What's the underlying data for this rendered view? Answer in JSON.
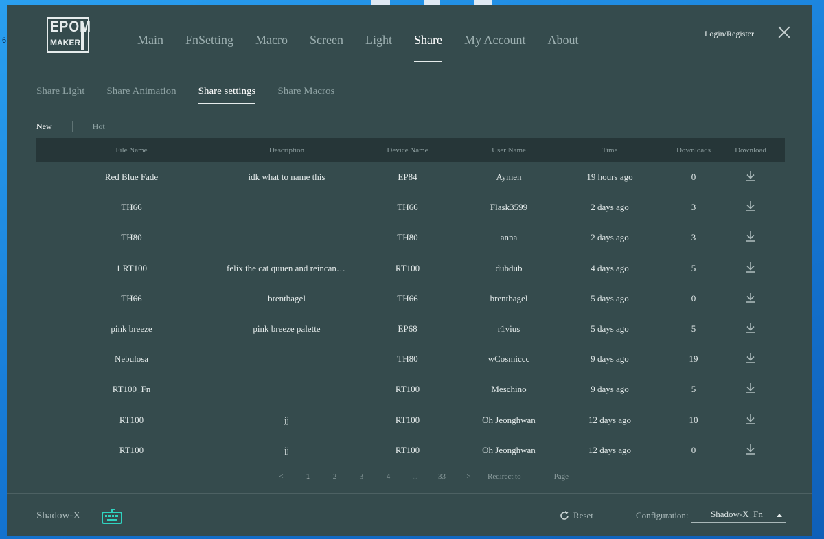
{
  "logo": {
    "line1": "EPOM",
    "line2": "MAKER"
  },
  "nav": [
    "Main",
    "FnSetting",
    "Macro",
    "Screen",
    "Light",
    "Share",
    "My Account",
    "About"
  ],
  "nav_active": "Share",
  "header": {
    "login_label": "Login/Register"
  },
  "subtabs": [
    "Share Light",
    "Share Animation",
    "Share settings",
    "Share Macros"
  ],
  "subtab_active": "Share settings",
  "filters": [
    "New",
    "Hot"
  ],
  "filter_active": "New",
  "table": {
    "columns": [
      "File Name",
      "Description",
      "Device Name",
      "User Name",
      "Time",
      "Downloads",
      "Download"
    ],
    "rows": [
      [
        "Red Blue Fade",
        "idk what to name this",
        "EP84",
        "Aymen",
        "19 hours ago",
        "0"
      ],
      [
        "TH66",
        "",
        "TH66",
        "Flask3599",
        "2 days ago",
        "3"
      ],
      [
        "TH80",
        "",
        "TH80",
        "anna",
        "2 days ago",
        "3"
      ],
      [
        "1 RT100",
        "felix the cat quuen and reincanated…",
        "RT100",
        "dubdub",
        "4 days ago",
        "5"
      ],
      [
        "TH66",
        "brentbagel",
        "TH66",
        "brentbagel",
        "5 days ago",
        "0"
      ],
      [
        "pink breeze",
        "pink breeze palette",
        "EP68",
        "r1vius",
        "5 days ago",
        "5"
      ],
      [
        "Nebulosa",
        "",
        "TH80",
        "wCosmiccc",
        "9 days ago",
        "19"
      ],
      [
        "RT100_Fn",
        "",
        "RT100",
        "Meschino",
        "9 days ago",
        "5"
      ],
      [
        "RT100",
        "jj",
        "RT100",
        "Oh Jeonghwan",
        "12 days ago",
        "10"
      ],
      [
        "RT100",
        "jj",
        "RT100",
        "Oh Jeonghwan",
        "12 days ago",
        "0"
      ]
    ]
  },
  "pager": {
    "prev": "<",
    "pages": [
      "1",
      "2",
      "3",
      "4",
      "...",
      "33"
    ],
    "next": ">",
    "current": "1",
    "redirect_label": "Redirect to",
    "page_label": "Page"
  },
  "footer": {
    "device": "Shadow-X",
    "reset_label": "Reset",
    "config_label": "Configuration:",
    "config_value": "Shadow-X_Fn"
  },
  "icons": {
    "download": "download-icon",
    "keyboard": "keyboard-icon",
    "reset": "refresh-icon",
    "close": "close-icon"
  },
  "colors": {
    "window_bg": "#354b4d",
    "header_row_bg": "#263638",
    "accent_keyboard": "#2fd3c0"
  }
}
